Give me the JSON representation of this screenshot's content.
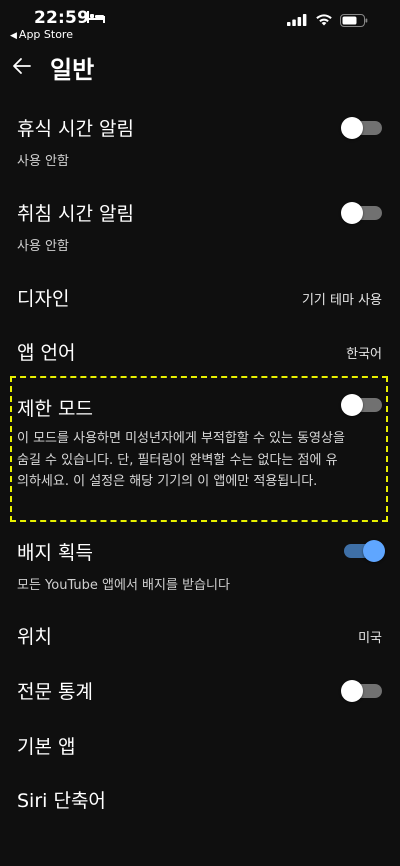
{
  "status_bar": {
    "time": "22:59",
    "back_app_label": "App Store",
    "back_app_glyph": "◀"
  },
  "header": {
    "title": "일반"
  },
  "settings": {
    "break_reminder": {
      "title": "휴식 시간 알림",
      "subtitle": "사용 안함",
      "enabled": false
    },
    "bedtime_reminder": {
      "title": "취침 시간 알림",
      "subtitle": "사용 안함",
      "enabled": false
    },
    "design": {
      "title": "디자인",
      "value": "기기 테마 사용"
    },
    "app_language": {
      "title": "앱 언어",
      "value": "한국어"
    },
    "restricted_mode": {
      "title": "제한 모드",
      "description": "이 모드를 사용하면 미성년자에게 부적합할 수 있는 동영상을 숨길 수 있습니다. 단, 필터링이 완벽할 수는 없다는 점에 유의하세요. 이 설정은 해당 기기의 이 앱에만 적용됩니다.",
      "enabled": false
    },
    "earn_badges": {
      "title": "배지 획득",
      "subtitle": "모든 YouTube 앱에서 배지를 받습니다",
      "enabled": true
    },
    "location": {
      "title": "위치",
      "value": "미국"
    },
    "stats_for_nerds": {
      "title": "전문 통계",
      "enabled": false
    },
    "default_apps": {
      "title": "기본 앱"
    },
    "siri_shortcuts": {
      "title": "Siri 단축어"
    }
  },
  "colors": {
    "background": "#0f0f0f",
    "toggle_off_track": "#717171",
    "toggle_on_track": "#3e6fa6",
    "toggle_on_knob": "#5fa6ff",
    "highlight": "#e8f000"
  },
  "icons": {
    "back": "arrow-left-icon",
    "signal": "cellular-signal-icon",
    "wifi": "wifi-icon",
    "battery": "battery-icon",
    "sleep": "bed-icon"
  }
}
